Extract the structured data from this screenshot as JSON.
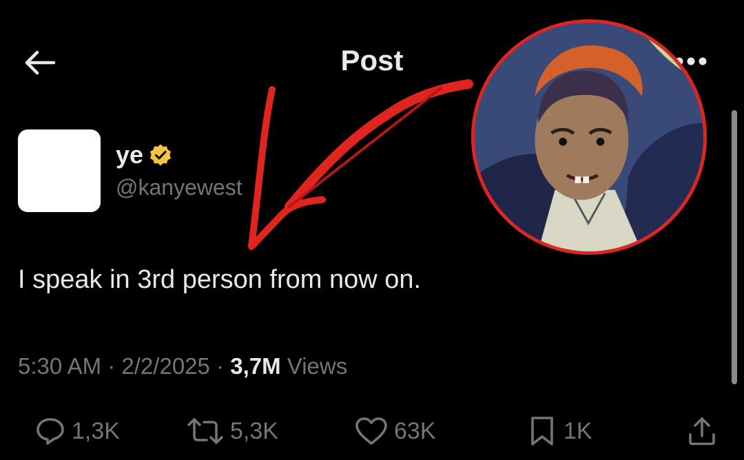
{
  "header": {
    "title": "Post",
    "icons": {
      "back": "arrow-left-icon",
      "more": "more-horizontal-icon"
    }
  },
  "author": {
    "display_name": "ye",
    "handle": "@kanyewest",
    "verified": true,
    "verified_color": "#f4c542"
  },
  "post": {
    "text": "I speak in 3rd person from now on.",
    "time": "5:30 AM",
    "date": "2/2/2025",
    "separator": "·",
    "views_count": "3,7M",
    "views_label": "Views"
  },
  "actions": {
    "replies": "1,3K",
    "reposts": "5,3K",
    "likes": "63K",
    "bookmarks": "1K",
    "icons": [
      "reply-icon",
      "repost-icon",
      "like-icon",
      "bookmark-icon",
      "share-icon"
    ]
  },
  "colors": {
    "background": "#000000",
    "primary_text": "#e7e9ea",
    "secondary_text": "#71767b",
    "annotation_red": "#e0251f"
  }
}
